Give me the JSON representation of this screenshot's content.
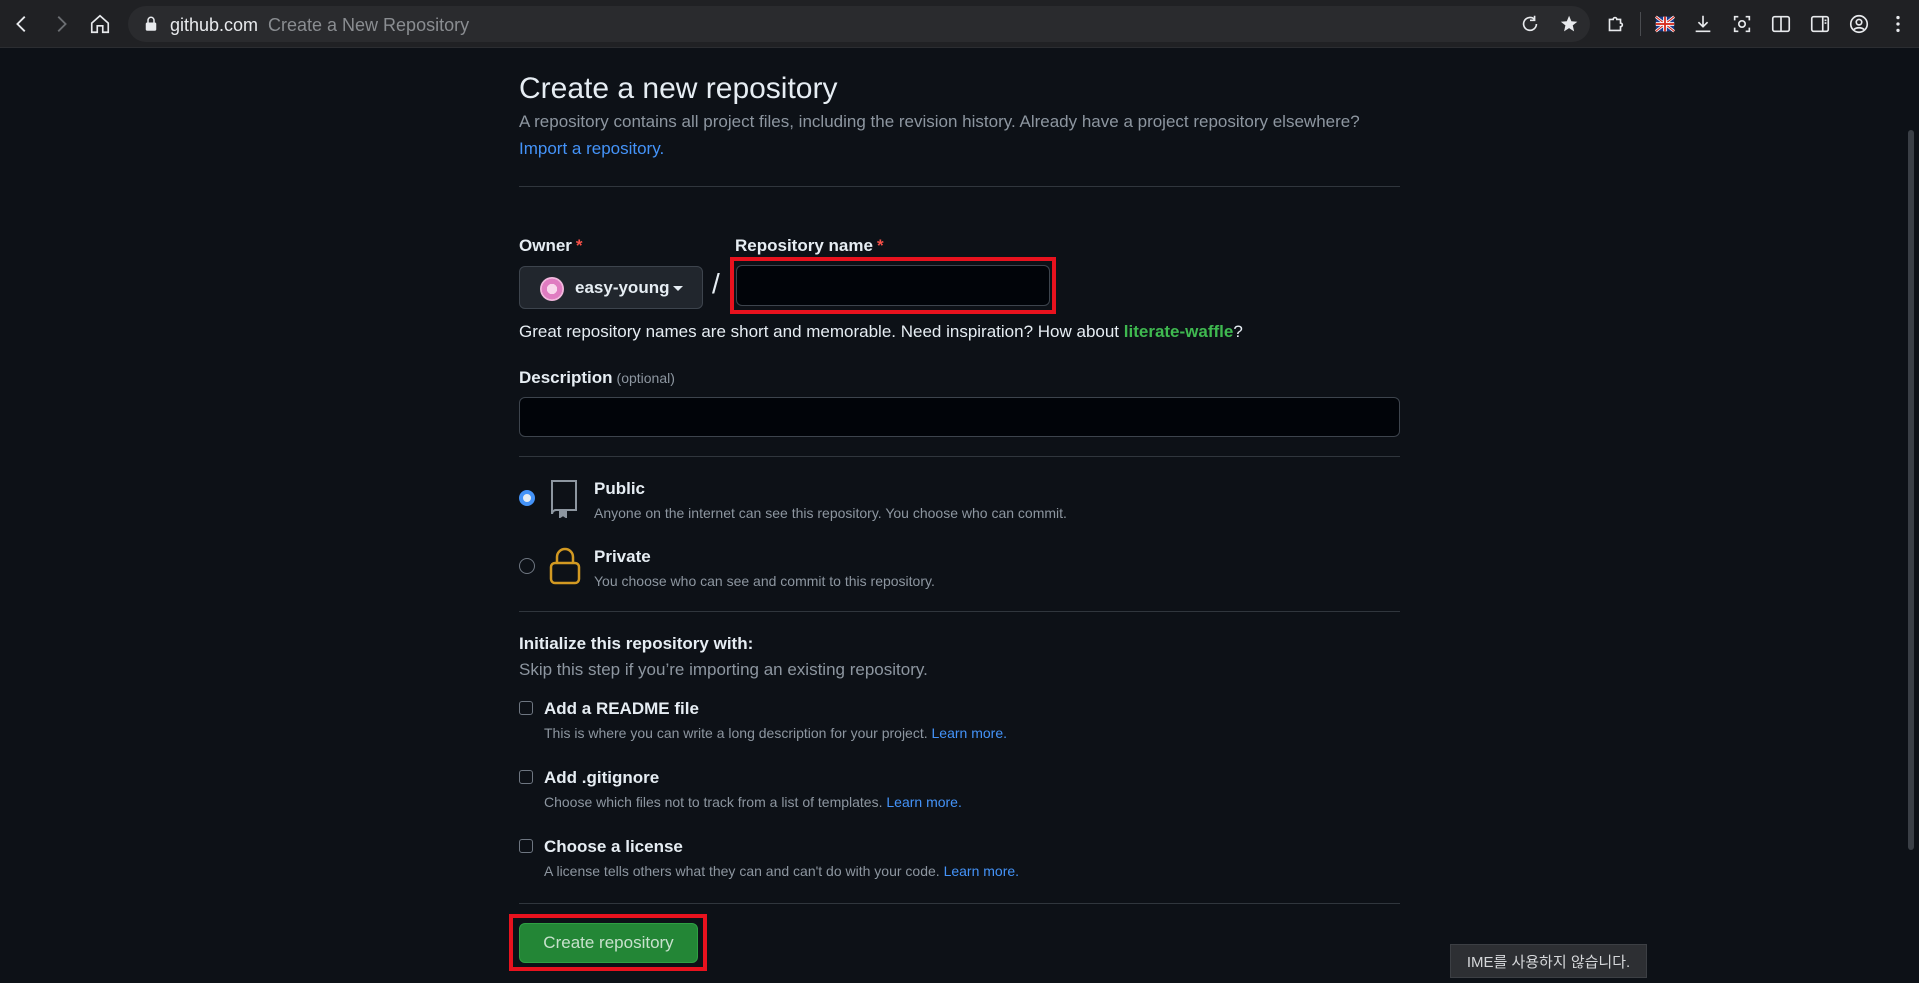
{
  "browser": {
    "domain": "github.com",
    "page_title": "Create a New Repository"
  },
  "page": {
    "title": "Create a new repository",
    "lead": "A repository contains all project files, including the revision history. Already have a project repository elsewhere?",
    "import_link": "Import a repository."
  },
  "form": {
    "owner_label": "Owner",
    "owner_value": "easy-young",
    "repo_label": "Repository name",
    "required_mark": "*",
    "repo_value": "",
    "slash": "/",
    "hint_prefix": "Great repository names are short and memorable. Need inspiration? How about ",
    "hint_suggestion": "literate-waffle",
    "hint_suffix": "?",
    "description_label": "Description",
    "description_optional": "(optional)",
    "description_value": ""
  },
  "visibility": {
    "selected": "public",
    "options": [
      {
        "title": "Public",
        "desc": "Anyone on the internet can see this repository. You choose who can commit."
      },
      {
        "title": "Private",
        "desc": "You choose who can see and commit to this repository."
      }
    ]
  },
  "initialize": {
    "title": "Initialize this repository with:",
    "subtitle": "Skip this step if you’re importing an existing repository.",
    "options": [
      {
        "title": "Add a README file",
        "desc": "This is where you can write a long description for your project.",
        "link": "Learn more.",
        "checked": false
      },
      {
        "title": "Add .gitignore",
        "desc": "Choose which files not to track from a list of templates.",
        "link": "Learn more.",
        "checked": false
      },
      {
        "title": "Choose a license",
        "desc": "A license tells others what they can and can't do with your code.",
        "link": "Learn more.",
        "checked": false
      }
    ]
  },
  "actions": {
    "create_label": "Create repository"
  },
  "toast": {
    "ime_message": "IME를 사용하지 않습니다."
  },
  "colors": {
    "background": "#0d1117",
    "accent_link": "#4493f8",
    "suggestion": "#3fb950",
    "primary_button": "#238636",
    "highlight_box": "#e8121e",
    "private_lock": "#d29922"
  }
}
